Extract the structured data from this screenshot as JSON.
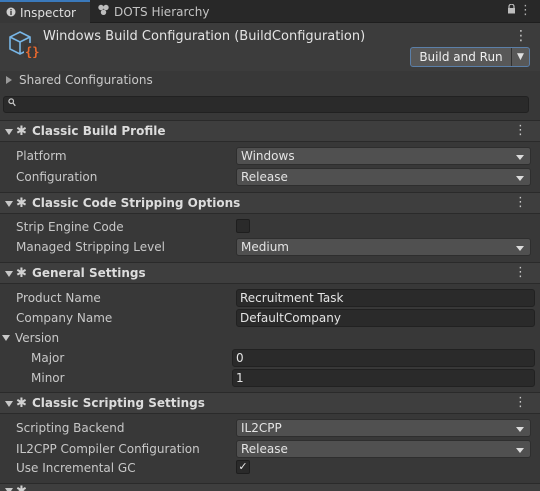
{
  "tabs": [
    {
      "label": "Inspector",
      "icon": "info-icon",
      "active": true
    },
    {
      "label": "DOTS Hierarchy",
      "icon": "hierarchy-icon",
      "active": false
    }
  ],
  "header": {
    "title": "Windows Build Configuration (BuildConfiguration)",
    "build_button_label": "Build and Run"
  },
  "shared_configurations_label": "Shared Configurations",
  "search": {
    "placeholder": ""
  },
  "sections": {
    "classic_build_profile": {
      "title": "Classic Build Profile",
      "platform_label": "Platform",
      "platform_value": "Windows",
      "configuration_label": "Configuration",
      "configuration_value": "Release"
    },
    "code_stripping": {
      "title": "Classic Code Stripping Options",
      "strip_engine_label": "Strip Engine Code",
      "strip_engine_checked": false,
      "managed_stripping_label": "Managed Stripping Level",
      "managed_stripping_value": "Medium"
    },
    "general": {
      "title": "General Settings",
      "product_name_label": "Product Name",
      "product_name_value": "Recruitment Task",
      "company_name_label": "Company Name",
      "company_name_value": "DefaultCompany",
      "version_label": "Version",
      "major_label": "Major",
      "major_value": "0",
      "minor_label": "Minor",
      "minor_value": "1"
    },
    "scripting": {
      "title": "Classic Scripting Settings",
      "backend_label": "Scripting Backend",
      "backend_value": "IL2CPP",
      "compiler_config_label": "IL2CPP Compiler Configuration",
      "compiler_config_value": "Release",
      "incremental_gc_label": "Use Incremental GC",
      "incremental_gc_checked": true
    }
  },
  "colors": {
    "accent": "#3a79bb",
    "button_border": "#5b7fa8",
    "background": "#383838"
  }
}
